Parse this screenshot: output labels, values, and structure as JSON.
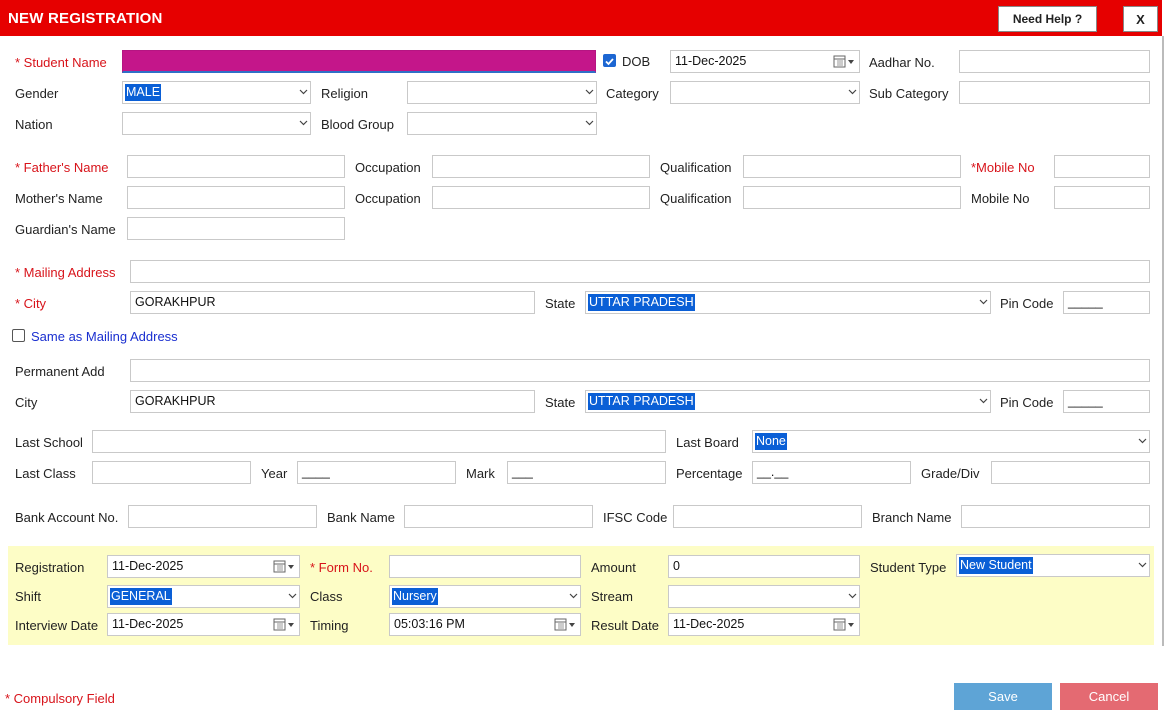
{
  "title": "NEW REGISTRATION",
  "header": {
    "help_label": "Need Help ?",
    "close_label": "X"
  },
  "student": {
    "name_label": "* Student Name",
    "dob_label": "DOB",
    "dob_value": "11-Dec-2025",
    "aadhar_label": "Aadhar No.",
    "gender_label": "Gender",
    "gender_value": "MALE",
    "religion_label": "Religion",
    "category_label": "Category",
    "subcategory_label": "Sub Category",
    "nation_label": "Nation",
    "blood_label": "Blood Group"
  },
  "parents": {
    "father_label": "* Father's Name",
    "occupation_label": "Occupation",
    "qualification_label": "Qualification",
    "father_mobile_label": "*Mobile No",
    "mother_label": "Mother's Name",
    "mother_mobile_label": "Mobile No",
    "guardian_label": "Guardian's Name"
  },
  "mailing": {
    "address_label": "* Mailing Address",
    "city_label": "* City",
    "city_value": "GORAKHPUR",
    "state_label": "State",
    "state_value": "UTTAR PRADESH",
    "pin_label": "Pin Code",
    "pin_value": "_____"
  },
  "same_as_label": "Same as Mailing Address",
  "permanent": {
    "address_label": "Permanent Add",
    "city_label": "City",
    "city_value": "GORAKHPUR",
    "state_label": "State",
    "state_value": "UTTAR PRADESH",
    "pin_label": "Pin Code",
    "pin_value": "_____"
  },
  "academic": {
    "last_school_label": "Last School",
    "last_board_label": "Last Board",
    "last_board_value": "None",
    "last_class_label": "Last Class",
    "year_label": "Year",
    "year_value": "____",
    "mark_label": "Mark",
    "mark_value": "___",
    "percentage_label": "Percentage",
    "percentage_value": "__.__",
    "grade_label": "Grade/Div"
  },
  "bank": {
    "account_label": "Bank Account No.",
    "bank_name_label": "Bank Name",
    "ifsc_label": "IFSC Code",
    "branch_label": "Branch Name"
  },
  "admission": {
    "registration_label": "Registration",
    "registration_value": "11-Dec-2025",
    "form_no_label": "* Form No.",
    "amount_label": "Amount",
    "amount_value": "0",
    "student_type_label": "Student Type",
    "student_type_value": "New Student",
    "shift_label": "Shift",
    "shift_value": "GENERAL",
    "class_label": "Class",
    "class_value": "Nursery",
    "stream_label": "Stream",
    "interview_label": "Interview Date",
    "interview_value": "11-Dec-2025",
    "timing_label": "Timing",
    "timing_value": "05:03:16 PM",
    "result_label": "Result Date",
    "result_value": "11-Dec-2025"
  },
  "footer": {
    "compulsory_label": "* Compulsory Field",
    "save_label": "Save",
    "cancel_label": "Cancel"
  },
  "colors": {
    "titlebar": "#e60000",
    "required": "#d8141b",
    "highlight": "#0a5fd6",
    "name_field": "#c4168a",
    "panel": "#fdfdc6",
    "save": "#5ea4d6",
    "cancel": "#e46a72"
  },
  "icons": [
    "chevron-down-icon",
    "calendar-icon",
    "checkbox-checked-icon",
    "checkbox-icon",
    "close-icon"
  ]
}
